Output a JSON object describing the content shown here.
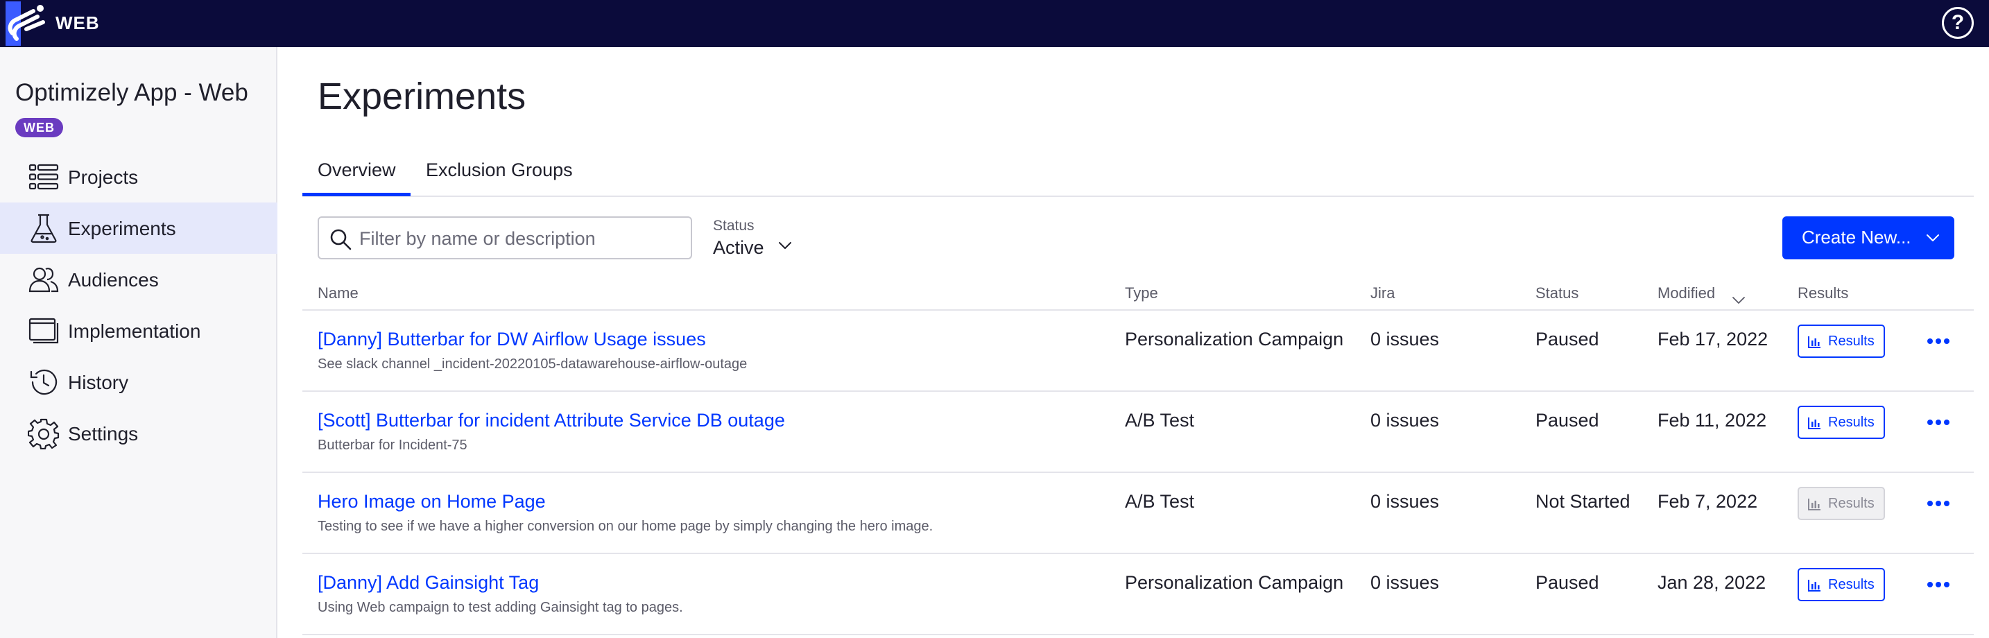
{
  "topbar": {
    "app_type": "WEB",
    "help_label": "?"
  },
  "sidebar": {
    "project_name": "Optimizely App - Web",
    "project_badge": "WEB",
    "items": [
      {
        "label": "Projects",
        "icon": "list-icon",
        "active": false
      },
      {
        "label": "Experiments",
        "icon": "flask-icon",
        "active": true
      },
      {
        "label": "Audiences",
        "icon": "people-icon",
        "active": false
      },
      {
        "label": "Implementation",
        "icon": "window-stack-icon",
        "active": false
      },
      {
        "label": "History",
        "icon": "history-icon",
        "active": false
      },
      {
        "label": "Settings",
        "icon": "gear-icon",
        "active": false
      }
    ]
  },
  "main": {
    "title": "Experiments",
    "tabs": [
      {
        "label": "Overview",
        "selected": true
      },
      {
        "label": "Exclusion Groups",
        "selected": false
      }
    ],
    "search": {
      "placeholder": "Filter by name or description",
      "value": ""
    },
    "status_filter": {
      "label": "Status",
      "value": "Active"
    },
    "create_button": {
      "label": "Create New..."
    }
  },
  "table": {
    "columns": [
      "Name",
      "Type",
      "Jira",
      "Status",
      "Modified",
      "Results"
    ],
    "sort_column": "Modified",
    "rows": [
      {
        "name": "[Danny] Butterbar for DW Airflow Usage issues",
        "description": "See slack channel _incident-20220105-datawarehouse-airflow-outage",
        "type": "Personalization Campaign",
        "jira": "0 issues",
        "status": "Paused",
        "modified": "Feb 17, 2022",
        "results": "Results",
        "results_enabled": true
      },
      {
        "name": "[Scott] Butterbar for incident Attribute Service DB outage",
        "description": "Butterbar for Incident-75",
        "type": "A/B Test",
        "jira": "0 issues",
        "status": "Paused",
        "modified": "Feb 11, 2022",
        "results": "Results",
        "results_enabled": true
      },
      {
        "name": "Hero Image on Home Page",
        "description": "Testing to see if we have a higher conversion on our home page by simply changing the hero image.",
        "type": "A/B Test",
        "jira": "0 issues",
        "status": "Not Started",
        "modified": "Feb 7, 2022",
        "results": "Results",
        "results_enabled": false
      },
      {
        "name": "[Danny] Add Gainsight Tag",
        "description": "Using Web campaign to test adding Gainsight tag to pages.",
        "type": "Personalization Campaign",
        "jira": "0 issues",
        "status": "Paused",
        "modified": "Jan 28, 2022",
        "results": "Results",
        "results_enabled": true
      }
    ]
  },
  "colors": {
    "topbar": "#0b0b3b",
    "accent": "#0037ff",
    "badge": "#6a3bc0",
    "active_nav": "#e5e8fb"
  }
}
